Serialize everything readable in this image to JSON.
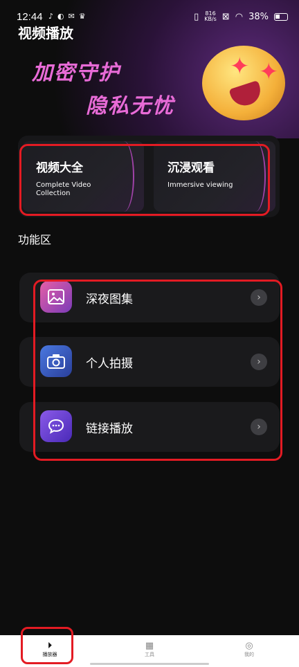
{
  "status": {
    "time": "12:44",
    "netspeed_value": "816",
    "netspeed_unit": "KB/s",
    "battery": "38%"
  },
  "header": {
    "title": "视频播放"
  },
  "banner": {
    "line1": "加密守护",
    "line2": "隐私无忧"
  },
  "features": [
    {
      "title": "视频大全",
      "subtitle": "Complete Video Collection"
    },
    {
      "title": "沉浸观看",
      "subtitle": "Immersive viewing"
    }
  ],
  "section": {
    "title": "功能区"
  },
  "functions": [
    {
      "label": "深夜图集",
      "icon": "image-icon",
      "color": "#c04cb0"
    },
    {
      "label": "个人拍摄",
      "icon": "camera-icon",
      "color": "#3a64c8"
    },
    {
      "label": "链接播放",
      "icon": "chat-bubble-icon",
      "color": "#6a3ad0"
    }
  ],
  "tabs": [
    {
      "label": "播放器",
      "icon": "play-icon"
    },
    {
      "label": "工具",
      "icon": "grid-icon"
    },
    {
      "label": "我的",
      "icon": "user-icon"
    }
  ],
  "colors": {
    "accent": "#e86bd7",
    "highlight_border": "#e31b23"
  }
}
